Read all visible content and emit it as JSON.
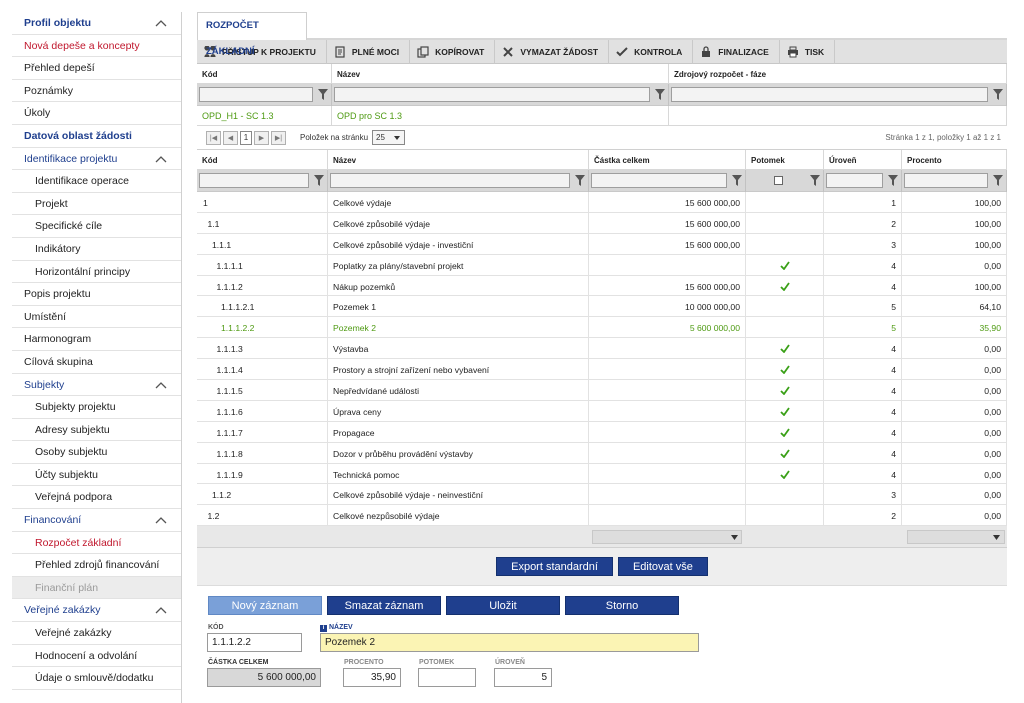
{
  "sidebar": {
    "items": [
      {
        "label": "Profil objektu",
        "kind": "header",
        "chevron": true
      },
      {
        "label": "Nová depeše a koncepty",
        "kind": "red"
      },
      {
        "label": "Přehled depeší",
        "kind": "normal"
      },
      {
        "label": "Poznámky",
        "kind": "normal"
      },
      {
        "label": "Úkoly",
        "kind": "normal"
      },
      {
        "label": "Datová oblast žádosti",
        "kind": "header"
      },
      {
        "label": "Identifikace projektu",
        "kind": "section",
        "chevron": true
      },
      {
        "label": "Identifikace operace",
        "kind": "sub"
      },
      {
        "label": "Projekt",
        "kind": "sub"
      },
      {
        "label": "Specifické cíle",
        "kind": "sub"
      },
      {
        "label": "Indikátory",
        "kind": "sub"
      },
      {
        "label": "Horizontální principy",
        "kind": "sub"
      },
      {
        "label": "Popis projektu",
        "kind": "normal"
      },
      {
        "label": "Umístění",
        "kind": "normal"
      },
      {
        "label": "Harmonogram",
        "kind": "normal"
      },
      {
        "label": "Cílová skupina",
        "kind": "normal"
      },
      {
        "label": "Subjekty",
        "kind": "section",
        "chevron": true
      },
      {
        "label": "Subjekty projektu",
        "kind": "sub"
      },
      {
        "label": "Adresy subjektu",
        "kind": "sub"
      },
      {
        "label": "Osoby subjektu",
        "kind": "sub"
      },
      {
        "label": "Účty subjektu",
        "kind": "sub"
      },
      {
        "label": "Veřejná podpora",
        "kind": "sub"
      },
      {
        "label": "Financování",
        "kind": "section",
        "chevron": true
      },
      {
        "label": "Rozpočet základní",
        "kind": "sub-red"
      },
      {
        "label": "Přehled zdrojů financování",
        "kind": "sub"
      },
      {
        "label": "Finanční plán",
        "kind": "sub-disabled"
      },
      {
        "label": "Veřejné zakázky",
        "kind": "section",
        "chevron": true
      },
      {
        "label": "Veřejné zakázky",
        "kind": "sub"
      },
      {
        "label": "Hodnocení a odvolání",
        "kind": "sub"
      },
      {
        "label": "Údaje o smlouvě/dodatku",
        "kind": "sub"
      }
    ]
  },
  "tab": {
    "label": "ROZPOČET ZÁKLADNÍ"
  },
  "toolbar": {
    "buttons": [
      {
        "label": "PŘÍSTUP K PROJEKTU",
        "icon": "people-icon"
      },
      {
        "label": "PLNÉ MOCI",
        "icon": "document-icon"
      },
      {
        "label": "KOPÍROVAT",
        "icon": "copy-icon"
      },
      {
        "label": "VYMAZAT ŽÁDOST",
        "icon": "x-icon"
      },
      {
        "label": "KONTROLA",
        "icon": "check-icon"
      },
      {
        "label": "FINALIZACE",
        "icon": "lock-icon"
      },
      {
        "label": "TISK",
        "icon": "print-icon"
      }
    ]
  },
  "top_grid": {
    "headers": [
      "Kód",
      "Název",
      "Zdrojový rozpočet - fáze"
    ],
    "row": [
      "OPD_H1 - SC 1.3",
      "OPD pro SC 1.3",
      ""
    ]
  },
  "pager": {
    "page": "1",
    "per_page_label": "Položek na stránku",
    "per_page_value": "25",
    "info": "Stránka 1 z 1, položky 1 až 1 z 1"
  },
  "budget_grid": {
    "headers": [
      "Kód",
      "Název",
      "Částka celkem",
      "Potomek",
      "Úroveň",
      "Procento"
    ],
    "rows": [
      {
        "code": "1",
        "indent": 0,
        "name": "Celkové výdaje",
        "amount": "15 600 000,00",
        "child": false,
        "level": "1",
        "pct": "100,00"
      },
      {
        "code": "1.1",
        "indent": 1,
        "name": "Celkové způsobilé výdaje",
        "amount": "15 600 000,00",
        "child": false,
        "level": "2",
        "pct": "100,00"
      },
      {
        "code": "1.1.1",
        "indent": 2,
        "name": "Celkové způsobilé výdaje - investiční",
        "amount": "15 600 000,00",
        "child": false,
        "level": "3",
        "pct": "100,00"
      },
      {
        "code": "1.1.1.1",
        "indent": 3,
        "name": "Poplatky za plány/stavební projekt",
        "amount": "",
        "child": true,
        "level": "4",
        "pct": "0,00"
      },
      {
        "code": "1.1.1.2",
        "indent": 3,
        "name": "Nákup pozemků",
        "amount": "15 600 000,00",
        "child": true,
        "level": "4",
        "pct": "100,00"
      },
      {
        "code": "1.1.1.2.1",
        "indent": 4,
        "name": "Pozemek 1",
        "amount": "10 000 000,00",
        "child": false,
        "level": "5",
        "pct": "64,10"
      },
      {
        "code": "1.1.1.2.2",
        "indent": 4,
        "name": "Pozemek 2",
        "amount": "5 600 000,00",
        "child": false,
        "level": "5",
        "pct": "35,90",
        "selected": true
      },
      {
        "code": "1.1.1.3",
        "indent": 3,
        "name": "Výstavba",
        "amount": "",
        "child": true,
        "level": "4",
        "pct": "0,00"
      },
      {
        "code": "1.1.1.4",
        "indent": 3,
        "name": "Prostory a strojní zařízení nebo vybavení",
        "amount": "",
        "child": true,
        "level": "4",
        "pct": "0,00"
      },
      {
        "code": "1.1.1.5",
        "indent": 3,
        "name": "Nepředvídané události",
        "amount": "",
        "child": true,
        "level": "4",
        "pct": "0,00"
      },
      {
        "code": "1.1.1.6",
        "indent": 3,
        "name": "Úprava ceny",
        "amount": "",
        "child": true,
        "level": "4",
        "pct": "0,00"
      },
      {
        "code": "1.1.1.7",
        "indent": 3,
        "name": "Propagace",
        "amount": "",
        "child": true,
        "level": "4",
        "pct": "0,00"
      },
      {
        "code": "1.1.1.8",
        "indent": 3,
        "name": "Dozor v průběhu provádění výstavby",
        "amount": "",
        "child": true,
        "level": "4",
        "pct": "0,00"
      },
      {
        "code": "1.1.1.9",
        "indent": 3,
        "name": "Technická pomoc",
        "amount": "",
        "child": true,
        "level": "4",
        "pct": "0,00"
      },
      {
        "code": "1.1.2",
        "indent": 2,
        "name": "Celkové způsobilé výdaje - neinvestiční",
        "amount": "",
        "child": false,
        "level": "3",
        "pct": "0,00"
      },
      {
        "code": "1.2",
        "indent": 1,
        "name": "Celkové nezpůsobilé výdaje",
        "amount": "",
        "child": false,
        "level": "2",
        "pct": "0,00"
      }
    ]
  },
  "actions": {
    "export": "Export standardní",
    "edit_all": "Editovat vše"
  },
  "record_buttons": {
    "new": "Nový záznam",
    "delete": "Smazat záznam",
    "save": "Uložit",
    "cancel": "Storno"
  },
  "form": {
    "code_label": "KÓD",
    "code_value": "1.1.1.2.2",
    "name_label": "NÁZEV",
    "name_value": "Pozemek 2",
    "amount_label": "ČÁSTKA CELKEM",
    "amount_value": "5 600 000,00",
    "pct_label": "PROCENTO",
    "pct_value": "35,90",
    "child_label": "POTOMEK",
    "level_label": "ÚROVEŇ",
    "level_value": "5"
  },
  "colors": {
    "brand_blue": "#1f3f8e",
    "accent_green": "#4e9a12",
    "accent_red": "#c0172d"
  }
}
